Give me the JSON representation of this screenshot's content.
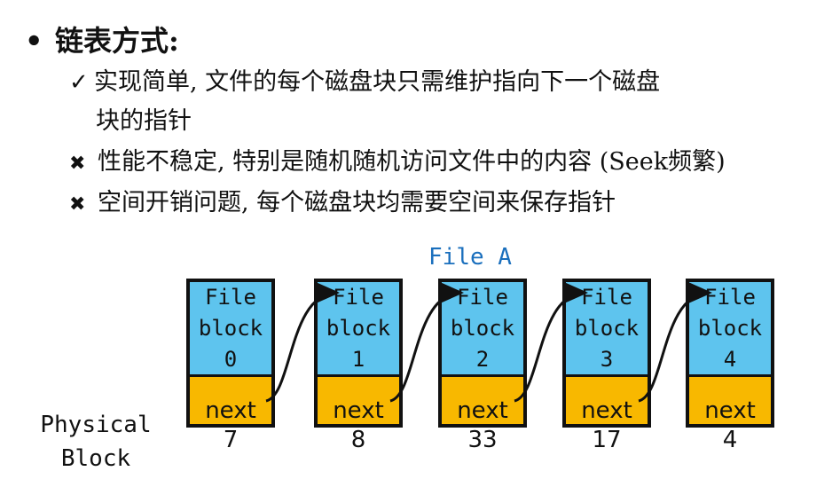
{
  "heading": {
    "bullet": "•",
    "text": "链表方式:"
  },
  "points": [
    {
      "mark": "✓",
      "line1": "实现简单, 文件的每个磁盘块只需维护指向下一个磁盘",
      "line2": "块的指针"
    },
    {
      "mark": "✖",
      "line1": "性能不稳定, 特别是随机随机访问文件中的内容 (Seek频繁)"
    },
    {
      "mark": "✖",
      "line1": "空间开销问题, 每个磁盘块均需要空间来保存指针"
    }
  ],
  "diagram": {
    "file_title": "File A",
    "physical_label_1": "Physical",
    "physical_label_2": "Block",
    "blocks": [
      {
        "line1": "File",
        "line2": "block",
        "index": "0",
        "next": "next",
        "physical": "7"
      },
      {
        "line1": "File",
        "line2": "block",
        "index": "1",
        "next": "next",
        "physical": "8"
      },
      {
        "line1": "File",
        "line2": "block",
        "index": "2",
        "next": "next",
        "physical": "33"
      },
      {
        "line1": "File",
        "line2": "block",
        "index": "3",
        "next": "next",
        "physical": "17"
      },
      {
        "line1": "File",
        "line2": "block",
        "index": "4",
        "next": "next",
        "physical": "4"
      }
    ],
    "colors": {
      "data": "#5ec4ee",
      "pointer": "#f8b800",
      "title": "#1a6fbd"
    }
  }
}
